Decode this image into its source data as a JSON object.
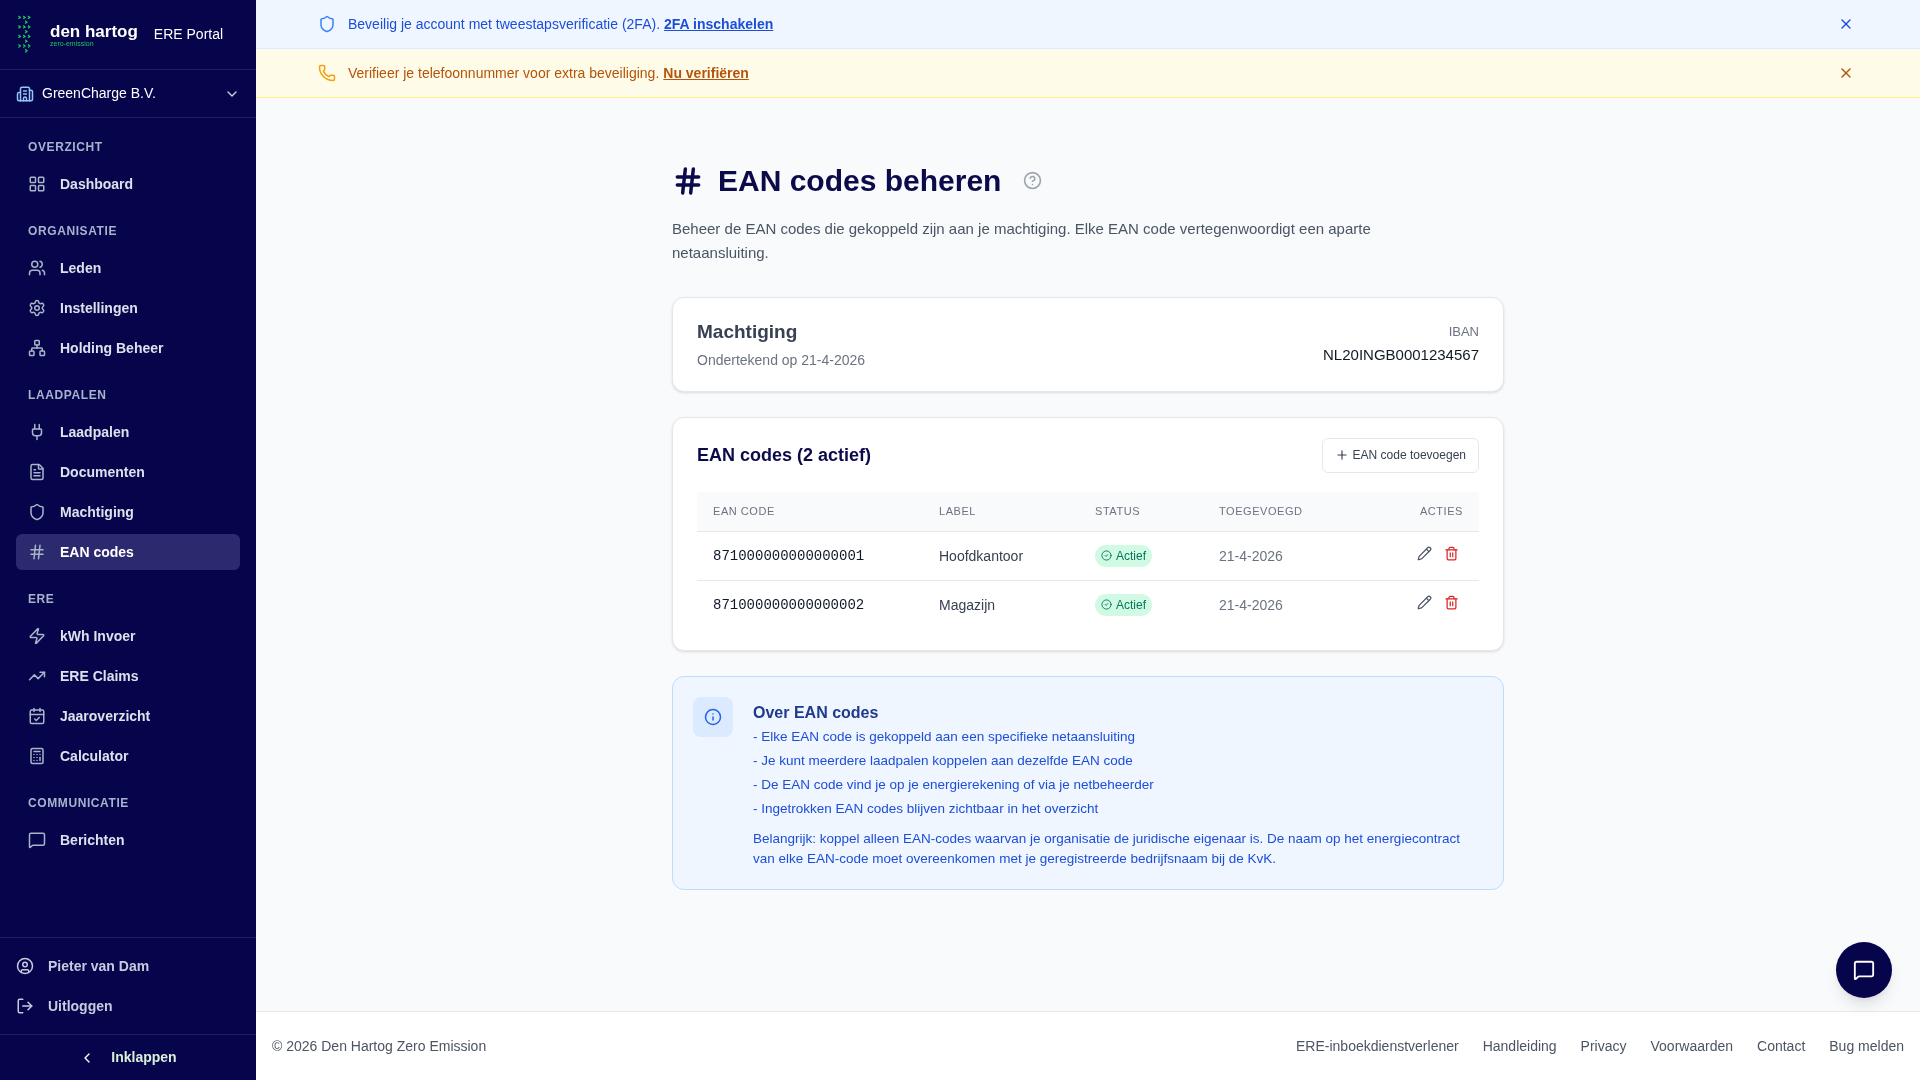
{
  "sidebar": {
    "logo": {
      "name": "den hartog",
      "tagline": "zero-emission"
    },
    "portal": "ERE Portal",
    "organization": "GreenCharge B.V.",
    "sections": [
      {
        "title": "OVERZICHT",
        "items": [
          {
            "label": "Dashboard",
            "selected": false
          }
        ]
      },
      {
        "title": "ORGANISATIE",
        "items": [
          {
            "label": "Leden",
            "selected": false
          },
          {
            "label": "Instellingen",
            "selected": false
          },
          {
            "label": "Holding Beheer",
            "selected": false
          }
        ]
      },
      {
        "title": "LAADPALEN",
        "items": [
          {
            "label": "Laadpalen",
            "selected": false
          },
          {
            "label": "Documenten",
            "selected": false
          },
          {
            "label": "Machtiging",
            "selected": false
          },
          {
            "label": "EAN codes",
            "selected": true
          }
        ]
      },
      {
        "title": "ERE",
        "items": [
          {
            "label": "kWh Invoer",
            "selected": false
          },
          {
            "label": "ERE Claims",
            "selected": false
          },
          {
            "label": "Jaaroverzicht",
            "selected": false
          },
          {
            "label": "Calculator",
            "selected": false
          }
        ]
      },
      {
        "title": "COMMUNICATIE",
        "items": [
          {
            "label": "Berichten",
            "selected": false
          }
        ]
      }
    ],
    "user": "Pieter van Dam",
    "logout": "Uitloggen",
    "collapse": "Inklappen"
  },
  "banners": [
    {
      "kind": "security",
      "text": "Beveilig je account met tweestapsverificatie (2FA).",
      "link": "2FA inschakelen"
    },
    {
      "kind": "phone",
      "text": "Verifieer je telefoonnummer voor extra beveiliging.",
      "link": "Nu verifiëren"
    }
  ],
  "page": {
    "title": "EAN codes beheren",
    "description": "Beheer de EAN codes die gekoppeld zijn aan je machtiging. Elke EAN code vertegenwoordigt een aparte netaansluiting."
  },
  "authorization": {
    "title": "Machtiging",
    "signed": "Ondertekend op 21-4-2026",
    "iban_label": "IBAN",
    "iban": "NL20INGB0001234567"
  },
  "ean_table": {
    "title": "EAN codes (2 actief)",
    "add_button": "EAN code toevoegen",
    "columns": [
      "EAN CODE",
      "LABEL",
      "STATUS",
      "TOEGEVOEGD",
      "ACTIES"
    ],
    "rows": [
      {
        "code": "871000000000000001",
        "label": "Hoofdkantoor",
        "status": "Actief",
        "added": "21-4-2026"
      },
      {
        "code": "871000000000000002",
        "label": "Magazijn",
        "status": "Actief",
        "added": "21-4-2026"
      }
    ]
  },
  "info": {
    "title": "Over EAN codes",
    "bullets": [
      "- Elke EAN code is gekoppeld aan een specifieke netaansluiting",
      "- Je kunt meerdere laadpalen koppelen aan dezelfde EAN code",
      "- De EAN code vind je op je energierekening of via je netbeheerder",
      "- Ingetrokken EAN codes blijven zichtbaar in het overzicht"
    ],
    "note": "Belangrijk: koppel alleen EAN-codes waarvan je organisatie de juridische eigenaar is. De naam op het energiecontract van elke EAN-code moet overeenkomen met je geregistreerde bedrijfsnaam bij de KvK."
  },
  "footer": {
    "copyright": "© 2026 Den Hartog Zero Emission",
    "links": [
      "ERE-inboekdienstverlener",
      "Handleiding",
      "Privacy",
      "Voorwaarden",
      "Contact",
      "Bug melden"
    ]
  }
}
